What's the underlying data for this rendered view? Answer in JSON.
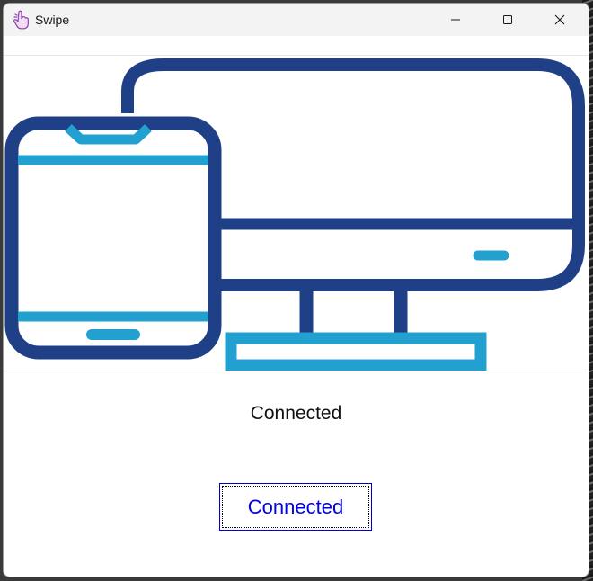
{
  "window": {
    "title": "Swipe",
    "app_icon": "pointing-hand-icon"
  },
  "titlebar_controls": [
    "minimize-icon",
    "maximize-icon",
    "close-icon"
  ],
  "illustration": {
    "description_icon": "phone-and-monitor-icon",
    "colors": {
      "dark": "#1f3f87",
      "accent": "#22a0d0"
    }
  },
  "status": {
    "text": "Connected"
  },
  "action_button": {
    "label": "Connected"
  }
}
